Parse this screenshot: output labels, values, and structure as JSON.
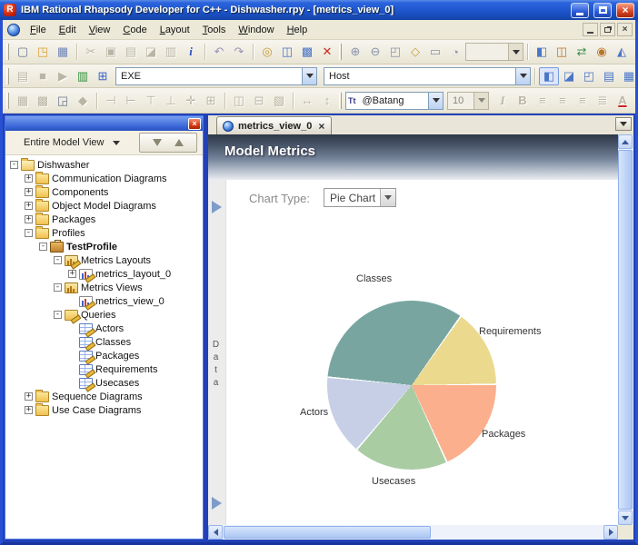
{
  "window": {
    "title": "IBM Rational Rhapsody Developer for C++ - Dishwasher.rpy - [metrics_view_0]",
    "app_icon": "rhapsody-logo-R",
    "controls": [
      "minimize",
      "maximize",
      "close"
    ]
  },
  "menu": {
    "items": [
      {
        "label": "File"
      },
      {
        "label": "Edit"
      },
      {
        "label": "View"
      },
      {
        "label": "Code"
      },
      {
        "label": "Layout"
      },
      {
        "label": "Tools"
      },
      {
        "label": "Window"
      },
      {
        "label": "Help"
      }
    ],
    "mdi_controls": [
      "minimize",
      "restore",
      "close"
    ]
  },
  "toolbars": {
    "tb1": {
      "g1": [
        {
          "n": "new-icon",
          "g": "▢",
          "c": "#6b7890"
        },
        {
          "n": "open-icon",
          "g": "◳",
          "c": "#d9a23c"
        },
        {
          "n": "save-icon",
          "g": "▦",
          "c": "#6f86b8"
        }
      ],
      "g2": [
        {
          "n": "cut-icon",
          "g": "✂",
          "s": "d"
        },
        {
          "n": "copy-icon",
          "g": "▣",
          "s": "d"
        },
        {
          "n": "paste-icon",
          "g": "▤",
          "s": "d"
        },
        {
          "n": "erase-icon",
          "g": "◪",
          "s": "d"
        },
        {
          "n": "print-icon",
          "g": "▥",
          "s": "d"
        },
        {
          "n": "info-icon",
          "g": "i",
          "k": "i",
          "c": "#2a52c8"
        }
      ],
      "g3": [
        {
          "n": "undo-icon",
          "g": "↶",
          "c": "#9a92b8"
        },
        {
          "n": "redo-icon",
          "g": "↷",
          "c": "#9a92b8"
        }
      ],
      "g4": [
        {
          "n": "search-icon",
          "g": "◎",
          "c": "#c89a32"
        },
        {
          "n": "open-target-window-icon",
          "g": "◫",
          "c": "#4a76c8"
        },
        {
          "n": "options-window-icon",
          "g": "▩",
          "c": "#4a76c8"
        },
        {
          "n": "delete-icon",
          "g": "✕",
          "c": "#cc2a1a"
        }
      ],
      "g5": [
        {
          "n": "zoom-in-icon",
          "g": "⊕",
          "c": "#8a94a8"
        },
        {
          "n": "zoom-out-icon",
          "g": "⊖",
          "c": "#8a94a8"
        },
        {
          "n": "zoom-area-icon",
          "g": "◰",
          "c": "#8a94a8"
        },
        {
          "n": "pan-icon",
          "g": "◇",
          "c": "#c8a23c"
        },
        {
          "n": "fit-to-window-icon",
          "g": "▭",
          "c": "#8a94a8"
        },
        {
          "n": "zoom-model-icon",
          "g": "◔",
          "c": "#8a94a8"
        }
      ],
      "zoom_combo_value": "",
      "g6": [
        {
          "n": "layout-sync-icon",
          "g": "◧",
          "c": "#4a76c8"
        },
        {
          "n": "component-tool-icon",
          "g": "◫",
          "c": "#b8762a"
        },
        {
          "n": "flow-tool-icon",
          "g": "⇄",
          "c": "#3b8f4a"
        },
        {
          "n": "actor-tool-icon",
          "g": "◉",
          "c": "#b8762a"
        },
        {
          "n": "screen-tool-icon",
          "g": "◭",
          "c": "#4a76c8"
        }
      ]
    },
    "tb2": {
      "g1": [
        {
          "n": "make-icon",
          "g": "▤",
          "s": "d"
        },
        {
          "n": "stop-make-icon",
          "g": "■",
          "s": "d"
        },
        {
          "n": "run-executable-icon",
          "g": "▶",
          "s": "d"
        },
        {
          "n": "animation-icon",
          "g": "▥",
          "c": "#2f8f3a"
        },
        {
          "n": "lock-config-icon",
          "g": "⊞",
          "c": "#3a62c8"
        }
      ],
      "exe_combo_value": "EXE",
      "host_combo_value": "Host",
      "g2": [
        {
          "n": "browser-window-icon",
          "g": "◧",
          "c": "#4a76c8",
          "s": "p"
        },
        {
          "n": "output-window-icon",
          "g": "◪",
          "c": "#4a76c8"
        },
        {
          "n": "features-window-icon",
          "g": "◰",
          "c": "#4a76c8"
        },
        {
          "n": "tabs-window-icon",
          "g": "▤",
          "c": "#4a76c8"
        }
      ],
      "g3": [
        {
          "n": "grid-window-icon",
          "g": "▦",
          "c": "#4a76c8"
        },
        {
          "n": "cascade-window-icon",
          "g": "◨",
          "c": "#4a76c8"
        }
      ],
      "g4": [
        {
          "n": "edit-diagram-icon",
          "g": "✎",
          "c": "#c89a32"
        }
      ],
      "g5": [
        {
          "n": "back-icon",
          "g": "⇦",
          "c": "#e0a23c"
        },
        {
          "n": "forward-icon",
          "g": "⇨",
          "c": "#e0a23c"
        }
      ],
      "g6": [
        {
          "n": "favorites-icon",
          "g": "★",
          "c": "#f0b63c"
        },
        {
          "n": "add-favorite-icon",
          "g": "★",
          "c": "#f0b63c"
        }
      ]
    },
    "tb3": {
      "g1": [
        {
          "n": "show-grid-icon",
          "g": "▦",
          "s": "d"
        },
        {
          "n": "snap-to-grid-icon",
          "g": "▩",
          "s": "d"
        },
        {
          "n": "stamp-mode-icon",
          "g": "◲",
          "c": "#6b7890"
        },
        {
          "n": "shape-icon",
          "g": "◆",
          "s": "d"
        }
      ],
      "g2": [
        {
          "n": "align-left-icon",
          "g": "⊣",
          "s": "d"
        },
        {
          "n": "align-right-icon",
          "g": "⊢",
          "s": "d"
        },
        {
          "n": "align-top-icon",
          "g": "⊤",
          "s": "d"
        },
        {
          "n": "align-bottom-icon",
          "g": "⊥",
          "s": "d"
        },
        {
          "n": "center-horizontal-icon",
          "g": "✛",
          "s": "d"
        },
        {
          "n": "center-vertical-icon",
          "g": "⊞",
          "s": "d"
        }
      ],
      "g3": [
        {
          "n": "distribute-horizontal-icon",
          "g": "◫",
          "s": "d"
        },
        {
          "n": "distribute-vertical-icon",
          "g": "⊟",
          "s": "d"
        },
        {
          "n": "same-size-icon",
          "g": "▧",
          "s": "d"
        }
      ],
      "g4": [
        {
          "n": "same-width-icon",
          "g": "↔",
          "s": "d"
        },
        {
          "n": "same-height-icon",
          "g": "↕",
          "s": "d"
        }
      ],
      "truetype_icon": "Tt",
      "font_combo_value": "@Batang",
      "size_combo_value": "10",
      "g5": [
        {
          "n": "italic-icon",
          "g": "I",
          "k": "i",
          "s": "d"
        },
        {
          "n": "bold-icon",
          "g": "B",
          "k": "b",
          "s": "d"
        },
        {
          "n": "align-text-left-icon",
          "g": "≡",
          "s": "d"
        },
        {
          "n": "align-text-center-icon",
          "g": "≡",
          "s": "d"
        },
        {
          "n": "align-text-right-icon",
          "g": "≡",
          "s": "d"
        },
        {
          "n": "list-format-icon",
          "g": "≣",
          "s": "d"
        },
        {
          "n": "font-color-icon",
          "g": "A",
          "k": "A",
          "s": "d"
        },
        {
          "n": "line-color-icon",
          "g": "∠",
          "s": "d"
        },
        {
          "n": "fill-color-icon",
          "g": "◆",
          "c": "#d9a23c"
        }
      ]
    }
  },
  "browser": {
    "view_selector_value": "Entire Model View",
    "tree": [
      {
        "label": "Dishwasher",
        "lvl": "0",
        "e": "-",
        "icon": "folder-open-icon",
        "b": ""
      },
      {
        "label": "Communication Diagrams",
        "lvl": "1",
        "e": "+",
        "icon": "folder-icon",
        "b": ""
      },
      {
        "label": "Components",
        "lvl": "1",
        "e": "+",
        "icon": "folder-icon",
        "b": ""
      },
      {
        "label": "Object Model Diagrams",
        "lvl": "1",
        "e": "+",
        "icon": "folder-icon",
        "b": ""
      },
      {
        "label": "Packages",
        "lvl": "1",
        "e": "+",
        "icon": "folder-icon",
        "b": ""
      },
      {
        "label": "Profiles",
        "lvl": "1",
        "e": "-",
        "icon": "folder-icon",
        "b": ""
      },
      {
        "label": "TestProfile",
        "lvl": "2",
        "e": "-",
        "icon": "profile-icon",
        "b": "b"
      },
      {
        "label": "Metrics Layouts",
        "lvl": "3",
        "e": "-",
        "icon": "layouts-icon",
        "b": ""
      },
      {
        "label": "metrics_layout_0",
        "lvl": "4",
        "e": "+",
        "icon": "layout-icon",
        "b": ""
      },
      {
        "label": "Metrics Views",
        "lvl": "3",
        "e": "-",
        "icon": "views-icon",
        "b": ""
      },
      {
        "label": "metrics_view_0",
        "lvl": "4",
        "e": "",
        "icon": "view-icon",
        "b": ""
      },
      {
        "label": "Queries",
        "lvl": "3",
        "e": "-",
        "icon": "queries-icon",
        "b": ""
      },
      {
        "label": "Actors",
        "lvl": "4",
        "e": "",
        "icon": "query-icon",
        "b": ""
      },
      {
        "label": "Classes",
        "lvl": "4",
        "e": "",
        "icon": "query-icon",
        "b": ""
      },
      {
        "label": "Packages",
        "lvl": "4",
        "e": "",
        "icon": "query-icon",
        "b": ""
      },
      {
        "label": "Requirements",
        "lvl": "4",
        "e": "",
        "icon": "query-icon",
        "b": ""
      },
      {
        "label": "Usecases",
        "lvl": "4",
        "e": "",
        "icon": "query-icon",
        "b": ""
      },
      {
        "label": "Sequence Diagrams",
        "lvl": "1",
        "e": "+",
        "icon": "folder-icon",
        "b": ""
      },
      {
        "label": "Use Case Diagrams",
        "lvl": "1",
        "e": "+",
        "icon": "folder-icon",
        "b": ""
      }
    ]
  },
  "editor": {
    "tab_label": "metrics_view_0",
    "tab_close": "×",
    "header_title": "Model Metrics",
    "chart_type_label": "Chart Type:",
    "chart_type_value": "Pie Chart",
    "side_label": "Data"
  },
  "chart_data": {
    "type": "pie",
    "title": "Model Metrics",
    "start_angle_deg": 0,
    "direction": "clockwise-from-3-oclock",
    "slices": [
      {
        "label": "Packages",
        "angle_deg": 66,
        "percent": 18.3,
        "color": "#FBAF8C"
      },
      {
        "label": "Usecases",
        "angle_deg": 65,
        "percent": 18.1,
        "color": "#A9CCA3"
      },
      {
        "label": "Actors",
        "angle_deg": 55,
        "percent": 15.3,
        "color": "#C6CFE5"
      },
      {
        "label": "Classes",
        "angle_deg": 120,
        "percent": 33.3,
        "color": "#78A5A0"
      },
      {
        "label": "Requirements",
        "angle_deg": 54,
        "percent": 15.0,
        "color": "#EBD98E"
      }
    ],
    "slice_gap_color": "#FFFFFF",
    "legend_position": "labels-around-pie"
  }
}
